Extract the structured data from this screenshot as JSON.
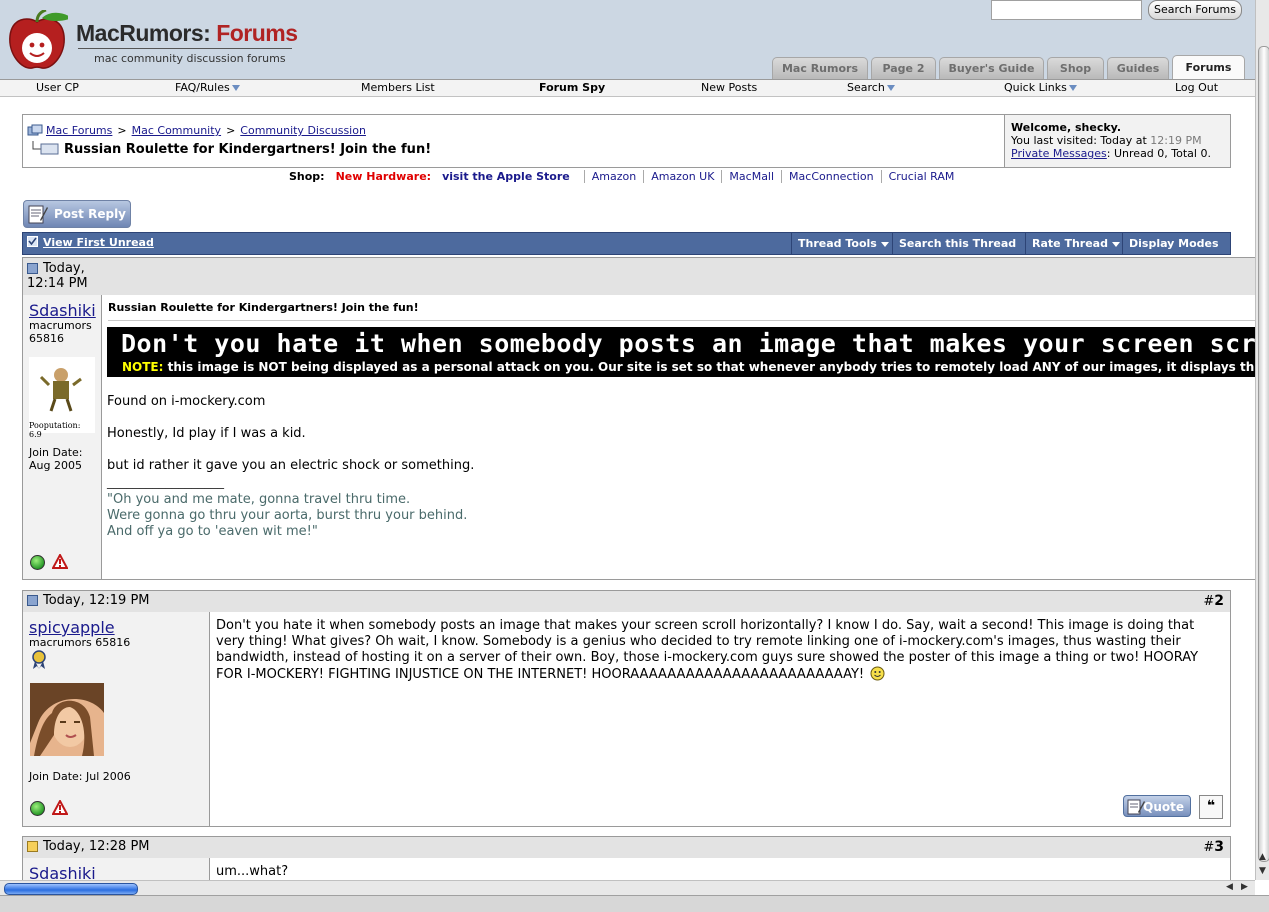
{
  "header": {
    "logo": {
      "brand_main": "MacRumors:",
      "brand_accent": " Forums",
      "tagline": "mac community discussion forums"
    },
    "search": {
      "placeholder": "",
      "button_label": "Search Forums"
    },
    "tabs": [
      {
        "label": "Mac Rumors",
        "active": false
      },
      {
        "label": "Page 2",
        "active": false
      },
      {
        "label": "Buyer's Guide",
        "active": false
      },
      {
        "label": "Shop",
        "active": false
      },
      {
        "label": "Guides",
        "active": false
      },
      {
        "label": "Forums",
        "active": true
      }
    ]
  },
  "navbar": {
    "items": [
      {
        "label": "User CP",
        "bold": false,
        "dropdown": false
      },
      {
        "label": "FAQ/Rules",
        "bold": false,
        "dropdown": true
      },
      {
        "label": "Members List",
        "bold": false,
        "dropdown": false
      },
      {
        "label": "Forum Spy",
        "bold": true,
        "dropdown": false
      },
      {
        "label": "New Posts",
        "bold": false,
        "dropdown": false
      },
      {
        "label": "Search",
        "bold": false,
        "dropdown": true
      },
      {
        "label": "Quick Links",
        "bold": false,
        "dropdown": true
      },
      {
        "label": "Log Out",
        "bold": false,
        "dropdown": false
      }
    ]
  },
  "breadcrumb": {
    "items": [
      "Mac Forums",
      "Mac Community",
      "Community Discussion"
    ],
    "separator": ">",
    "thread_title": "Russian Roulette for Kindergartners! Join the fun!"
  },
  "welcome": {
    "greeting": "Welcome, shecky.",
    "last_visited_label": "You last visited: Today at",
    "last_visited_time": "12:19 PM",
    "pm_link": "Private Messages",
    "pm_counts": ": Unread 0, Total 0."
  },
  "shop": {
    "label": "Shop:",
    "new_hardware": "New Hardware:",
    "links": [
      "visit the Apple Store",
      "Amazon",
      "Amazon UK",
      "MacMall",
      "MacConnection",
      "Crucial RAM"
    ]
  },
  "post_reply_label": "Post Reply",
  "thread_controls": {
    "view_first_unread": "View First Unread",
    "menus": [
      "Thread Tools",
      "Search this Thread",
      "Rate Thread",
      "Display Modes"
    ]
  },
  "posts": [
    {
      "date": "Today,",
      "time": "12:14 PM",
      "username": "Sdashiki",
      "user_title": "macrumors",
      "user_number": "65816",
      "pooputation": "Pooputation: 6.9",
      "join_date": "Join Date:",
      "join_date_value": "Aug 2005",
      "post_title": "Russian Roulette for Kindergartners! Join the fun!",
      "banner_big": "Don't you hate it when somebody posts an image that makes your screen scroll horizon",
      "banner_note": "NOTE:",
      "banner_small": " this image is NOT being displayed as a personal attack on you. Our site is set so that whenever anybody tries to remotely load ANY of our images, it displays this long",
      "lines": [
        "Found on i-mockery.com",
        "Honestly, Id play if I was a kid.",
        "but id rather it gave you an electric shock or something."
      ],
      "signature_separator": "__________________",
      "signature": [
        "\"Oh you and me mate, gonna travel thru time.",
        "Were gonna go thru your aorta, burst thru your behind.",
        "And off ya go to 'eaven wit me!\""
      ]
    },
    {
      "date_time": "Today, 12:19 PM",
      "number_prefix": "#",
      "number": "2",
      "username": "spicyapple",
      "user_title": "macrumors 65816",
      "join_date": "Join Date: Jul 2006",
      "message": "Don't you hate it when somebody posts an image that makes your screen scroll horizontally? I know I do. Say, wait a second! This image is doing that very thing! What gives? Oh wait, I know. Somebody is a genius who decided to try remote linking one of i-mockery.com's images, thus wasting their bandwidth, instead of hosting it on a server of their own. Boy, those i-mockery.com guys sure showed the poster of this image a thing or two! HOORAY FOR I-MOCKERY! FIGHTING INJUSTICE ON THE INTERNET! HOORAAAAAAAAAAAAAAAAAAAAAAAAY!",
      "quote_label": "Quote"
    },
    {
      "date_time": "Today, 12:28 PM",
      "number_prefix": "#",
      "number": "3",
      "username": "Sdashiki",
      "message": "um...what?"
    }
  ],
  "colors": {
    "header_bg": "#ccd7e3",
    "controls_bar": "#4d6a9e",
    "link": "#1a1a8c",
    "new_hardware": "#e00000",
    "brand_accent": "#b02323"
  },
  "icons": [
    "apple-logo",
    "search-field",
    "dropdown-triangle",
    "go-to-icon",
    "post-status-icon",
    "online-status-icon",
    "report-post-icon",
    "smiley-icon",
    "multi-quote-icon",
    "checkbox-icon"
  ]
}
